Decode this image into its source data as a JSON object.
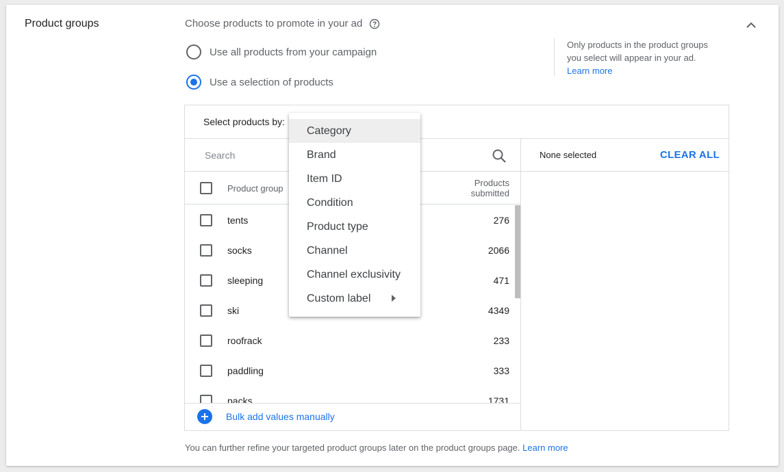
{
  "section": {
    "title": "Product groups"
  },
  "heading": {
    "text": "Choose products to promote in your ad"
  },
  "options": [
    {
      "label": "Use all products from your campaign",
      "checked": false
    },
    {
      "label": "Use a selection of products",
      "checked": true
    }
  ],
  "info": {
    "line1": "Only products in the product groups",
    "line2": "you select will appear in your ad.",
    "link": "Learn more"
  },
  "selector": {
    "label": "Select products by:",
    "search_placeholder": "Search",
    "columns": {
      "name": "Product group",
      "count_line1": "Products",
      "count_line2": "submitted"
    },
    "rows": [
      {
        "name": "tents",
        "count": "276"
      },
      {
        "name": "socks",
        "count": "2066"
      },
      {
        "name": "sleeping",
        "count": "471"
      },
      {
        "name": "ski",
        "count": "4349"
      },
      {
        "name": "roofrack",
        "count": "233"
      },
      {
        "name": "paddling",
        "count": "333"
      },
      {
        "name": "packs",
        "count": "1731"
      }
    ],
    "bulk_add": "Bulk add values manually",
    "selected_text": "None selected",
    "clear_all": "CLEAR ALL"
  },
  "menu": {
    "items": [
      {
        "label": "Category",
        "active": true
      },
      {
        "label": "Brand"
      },
      {
        "label": "Item ID"
      },
      {
        "label": "Condition"
      },
      {
        "label": "Product type"
      },
      {
        "label": "Channel"
      },
      {
        "label": "Channel exclusivity"
      },
      {
        "label": "Custom label",
        "submenu": true
      }
    ]
  },
  "footer": {
    "text": "You can further refine your targeted product groups later on the product groups page.",
    "link": "Learn more"
  },
  "colors": {
    "accent": "#1a73e8",
    "text_secondary": "#5f6368",
    "border": "#dadce0"
  },
  "icons": [
    "help-icon",
    "chevron-up-icon",
    "search-icon",
    "plus-circle-icon",
    "arrow-right-icon"
  ]
}
